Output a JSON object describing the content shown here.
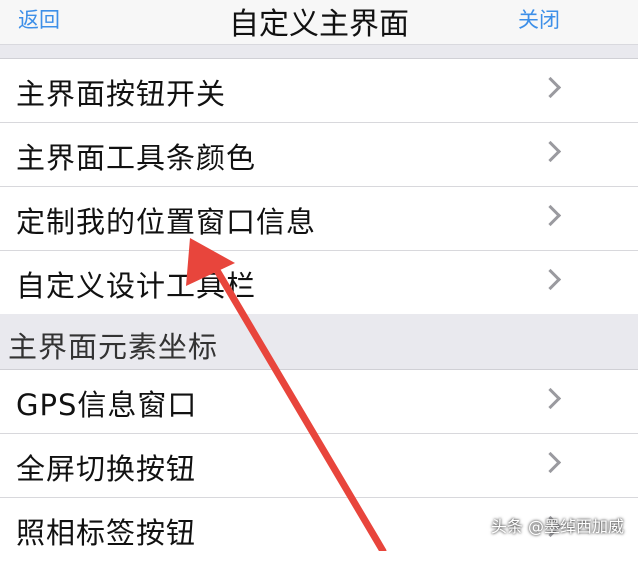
{
  "nav": {
    "back_label": "返回",
    "title": "自定义主界面",
    "close_label": "关闭"
  },
  "group1": {
    "items": [
      {
        "label": "主界面按钮开关"
      },
      {
        "label": "主界面工具条颜色"
      },
      {
        "label": "定制我的位置窗口信息"
      },
      {
        "label": "自定义设计工具栏"
      }
    ]
  },
  "section2": {
    "header": "主界面元素坐标",
    "items": [
      {
        "label": "GPS信息窗口"
      },
      {
        "label": "全屏切换按钮"
      },
      {
        "label": "照相标签按钮"
      }
    ]
  },
  "watermark": {
    "text": "头条 @墨绰西加威"
  },
  "colors": {
    "accent": "#3d8fe8",
    "annotation_arrow": "#e8453c"
  },
  "icons": [
    "chevron-right-icon",
    "red-arrow-annotation"
  ]
}
